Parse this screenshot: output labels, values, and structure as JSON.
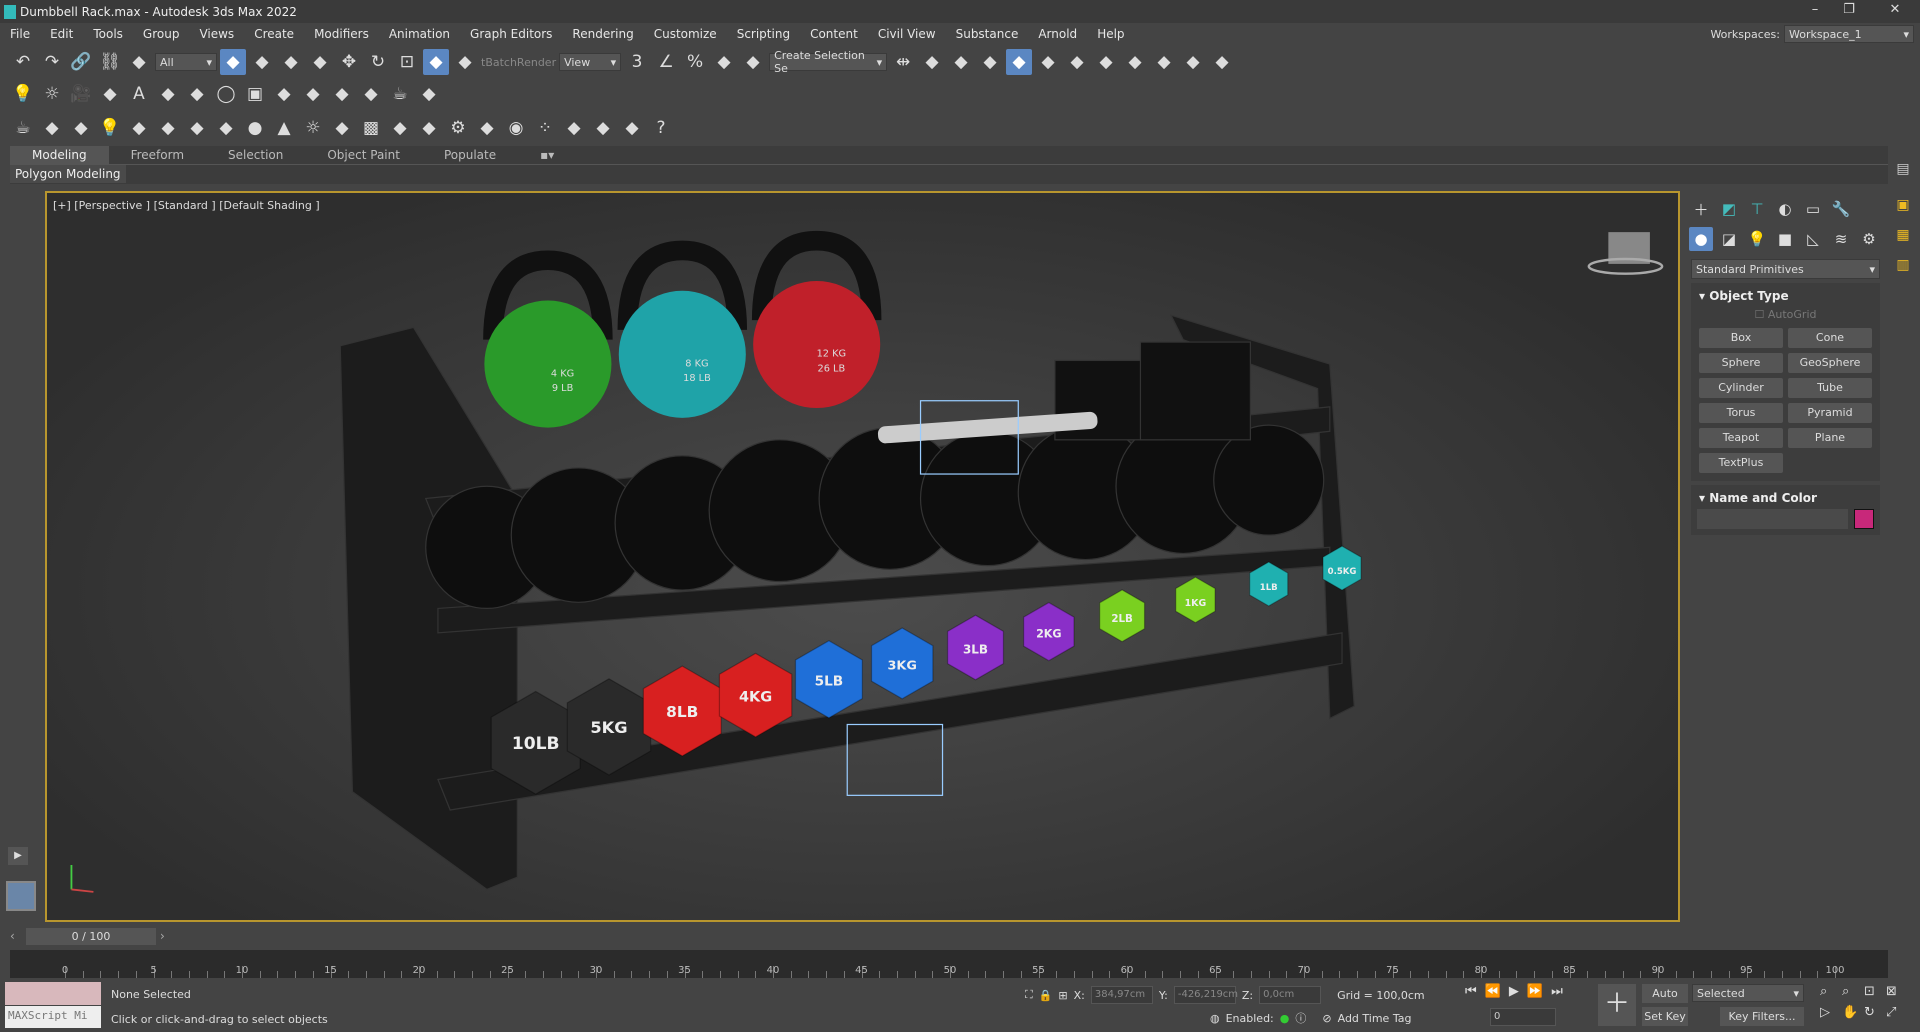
{
  "title": "Dumbbell Rack.max - Autodesk 3ds Max 2022",
  "menu": [
    "File",
    "Edit",
    "Tools",
    "Group",
    "Views",
    "Create",
    "Modifiers",
    "Animation",
    "Graph Editors",
    "Rendering",
    "Customize",
    "Scripting",
    "Content",
    "Civil View",
    "Substance",
    "Arnold",
    "Help"
  ],
  "workspace": {
    "label": "Workspaces:",
    "value": "Workspace_1"
  },
  "toolbar1": {
    "filter": "All",
    "batch": "tBatchRender",
    "view": "View",
    "selset": "Create Selection Se",
    "icons": [
      "undo-icon",
      "redo-icon",
      "link-icon",
      "unlink-icon",
      "bind-spacewarp-icon",
      "select-object-icon",
      "select-by-name-icon",
      "rect-region-icon",
      "window-crossing-icon",
      "move-icon",
      "rotate-icon",
      "scale-icon",
      "place-icon",
      "pivot-icon",
      "snap-icon",
      "angle-snap-icon",
      "percent-snap-icon",
      "spinner-snap-icon",
      "edit-named-sel-icon",
      "mirror-icon",
      "align-icon",
      "scene-explorer-icon",
      "layer-explorer-icon",
      "ribbon-toggle-icon",
      "curve-editor-icon",
      "dope-sheet-icon",
      "schematic-icon",
      "material-editor-icon",
      "render-setup-icon",
      "render-frame-icon",
      "render-icon"
    ]
  },
  "toolbar2": [
    "light-icon",
    "sun-icon",
    "camera-icon",
    "tree-icon",
    "text-icon",
    "pine-icon",
    "slice-icon",
    "torus-icon",
    "box-icon",
    "grid-icon",
    "helper-icon",
    "film-icon",
    "frame-icon",
    "teapot-icon",
    "bulb-icon"
  ],
  "toolbar3": [
    "teapot-icon",
    "sky-icon",
    "image-icon",
    "light-icon",
    "camera-group-icon",
    "dummy-icon",
    "plane-icon",
    "dome-icon",
    "sphere-icon",
    "cone-icon",
    "sun-icon",
    "disc-icon",
    "checker-icon",
    "capsule-icon",
    "pyramid-icon",
    "gear-icon",
    "grass-icon",
    "ball-icon",
    "dots-icon",
    "purple-icon",
    "cube-icon",
    "bottle-icon",
    "help-icon"
  ],
  "ribbon": {
    "tabs": [
      "Modeling",
      "Freeform",
      "Selection",
      "Object Paint",
      "Populate"
    ],
    "panel": "Polygon Modeling"
  },
  "viewport": {
    "label": "[+] [Perspective ] [Standard ] [Default Shading ]",
    "kettlebells": [
      {
        "l1": "4 KG",
        "l2": "9 LB",
        "color": "#2a9a2a"
      },
      {
        "l1": "8 KG",
        "l2": "18 LB",
        "color": "#1fa3a8"
      },
      {
        "l1": "12 KG",
        "l2": "26 LB",
        "color": "#c0202a"
      }
    ],
    "dumbbells": [
      {
        "label": "10LB",
        "color": "#2a2a2a"
      },
      {
        "label": "5KG",
        "color": "#2a2a2a"
      },
      {
        "label": "8LB",
        "color": "#d82020"
      },
      {
        "label": "4KG",
        "color": "#d82020"
      },
      {
        "label": "5LB",
        "color": "#1f6fd8"
      },
      {
        "label": "3KG",
        "color": "#1f6fd8"
      },
      {
        "label": "3LB",
        "color": "#8a2fc8"
      },
      {
        "label": "2KG",
        "color": "#8a2fc8"
      },
      {
        "label": "2LB",
        "color": "#7ad020"
      },
      {
        "label": "1KG",
        "color": "#7ad020"
      },
      {
        "label": "1LB",
        "color": "#1fb0b0"
      },
      {
        "label": "0.5KG",
        "color": "#1fb0b0"
      }
    ]
  },
  "command_panel": {
    "category": "Standard Primitives",
    "object_type": "Object Type",
    "autogrid": "AutoGrid",
    "buttons": [
      "Box",
      "Cone",
      "Sphere",
      "GeoSphere",
      "Cylinder",
      "Tube",
      "Torus",
      "Pyramid",
      "Teapot",
      "Plane",
      "TextPlus"
    ],
    "name_and_color": "Name and Color",
    "color": "#c8287a"
  },
  "timeline": {
    "position": "0 / 100",
    "ticks": [
      0,
      5,
      10,
      15,
      20,
      25,
      30,
      35,
      40,
      45,
      50,
      55,
      60,
      65,
      70,
      75,
      80,
      85,
      90,
      95,
      100
    ]
  },
  "status": {
    "selection": "None Selected",
    "prompt": "Click or click-and-drag to select objects",
    "maxscript": "MAXScript Mi",
    "x_label": "X:",
    "x": "384,97cm",
    "y_label": "Y:",
    "y": "-426,219cm",
    "z_label": "Z:",
    "z": "0,0cm",
    "grid": "Grid = 100,0cm",
    "enabled": "Enabled:",
    "add_time_tag": "Add Time Tag",
    "auto_key": "Auto Key",
    "set_key": "Set Key",
    "key_mode": "Selected",
    "key_filters": "Key Filters...",
    "frame": "0"
  }
}
